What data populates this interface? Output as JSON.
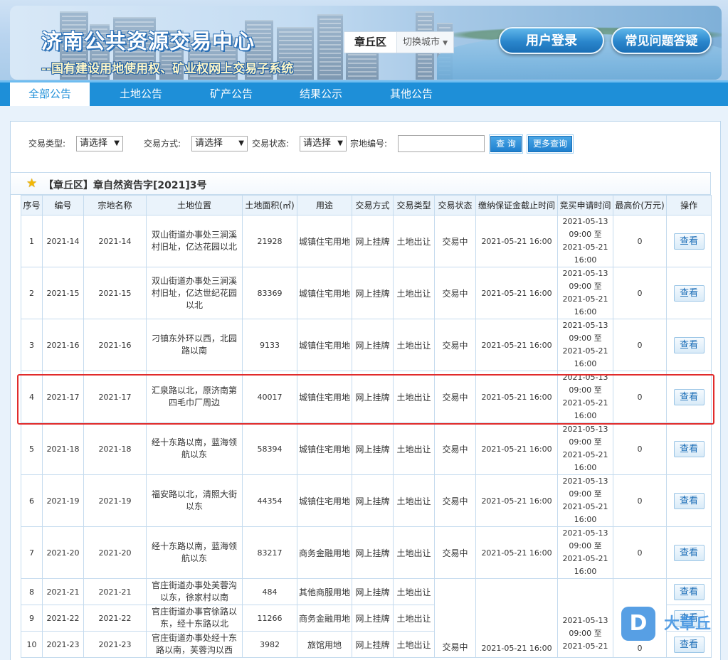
{
  "header": {
    "title": "济南公共资源交易中心",
    "subtitle": "--国有建设用地使用权、矿业权网上交易子系统",
    "city_current": "章丘区",
    "city_switch": "切换城市",
    "login_label": "用户登录",
    "faq_label": "常见问题答疑"
  },
  "nav": {
    "items": [
      {
        "label": "全部公告",
        "active": true
      },
      {
        "label": "土地公告",
        "active": false
      },
      {
        "label": "矿产公告",
        "active": false
      },
      {
        "label": "结果公示",
        "active": false
      },
      {
        "label": "其他公告",
        "active": false
      }
    ]
  },
  "filters": {
    "trade_type_label": "交易类型:",
    "trade_type_value": "请选择",
    "trade_mode_label": "交易方式:",
    "trade_mode_value": "请选择",
    "trade_status_label": "交易状态:",
    "trade_status_value": "请选择",
    "parcel_no_label": "宗地编号:",
    "parcel_no_value": "",
    "query_button": "查 询",
    "more_query_button": "更多查询"
  },
  "notice": {
    "title": "【章丘区】章自然资告字[2021]3号"
  },
  "table": {
    "headers": [
      "序号",
      "编号",
      "宗地名称",
      "土地位置",
      "土地面积(㎡)",
      "用途",
      "交易方式",
      "交易类型",
      "交易状态",
      "缴纳保证金截止时间",
      "竞买申请时间",
      "最高价(万元)",
      "操作"
    ],
    "rows": [
      {
        "no": "1",
        "code": "2021-14",
        "name": "2021-14",
        "location": "双山街道办事处三涧溪村旧址，亿达花园以北",
        "area": "21928",
        "use": "城镇住宅用地",
        "mode": "网上挂牌",
        "type": "土地出让",
        "status": "交易中",
        "deposit_deadline": "2021-05-21 16:00",
        "bid_start": "2021-05-13",
        "bid_start_time": "09:00 至",
        "bid_end": "2021-05-21",
        "bid_end_time": "16:00",
        "max_price": "0",
        "action": "查看"
      },
      {
        "no": "2",
        "code": "2021-15",
        "name": "2021-15",
        "location": "双山街道办事处三涧溪村旧址，亿达世纪花园以北",
        "area": "83369",
        "use": "城镇住宅用地",
        "mode": "网上挂牌",
        "type": "土地出让",
        "status": "交易中",
        "deposit_deadline": "2021-05-21 16:00",
        "bid_start": "2021-05-13",
        "bid_start_time": "09:00 至",
        "bid_end": "2021-05-21",
        "bid_end_time": "16:00",
        "max_price": "0",
        "action": "查看"
      },
      {
        "no": "3",
        "code": "2021-16",
        "name": "2021-16",
        "location": "刁镇东外环以西，北园路以南",
        "area": "9133",
        "use": "城镇住宅用地",
        "mode": "网上挂牌",
        "type": "土地出让",
        "status": "交易中",
        "deposit_deadline": "2021-05-21 16:00",
        "bid_start": "2021-05-13",
        "bid_start_time": "09:00 至",
        "bid_end": "2021-05-21",
        "bid_end_time": "16:00",
        "max_price": "0",
        "action": "查看"
      },
      {
        "no": "4",
        "code": "2021-17",
        "name": "2021-17",
        "location": "汇泉路以北，原济南第四毛巾厂周边",
        "area": "40017",
        "use": "城镇住宅用地",
        "mode": "网上挂牌",
        "type": "土地出让",
        "status": "交易中",
        "deposit_deadline": "2021-05-21 16:00",
        "bid_start": "2021-05-13",
        "bid_start_time": "09:00 至",
        "bid_end": "2021-05-21",
        "bid_end_time": "16:00",
        "max_price": "0",
        "action": "查看"
      },
      {
        "no": "5",
        "code": "2021-18",
        "name": "2021-18",
        "location": "经十东路以南，蓝海领航以东",
        "area": "58394",
        "use": "城镇住宅用地",
        "mode": "网上挂牌",
        "type": "土地出让",
        "status": "交易中",
        "deposit_deadline": "2021-05-21 16:00",
        "bid_start": "2021-05-13",
        "bid_start_time": "09:00 至",
        "bid_end": "2021-05-21",
        "bid_end_time": "16:00",
        "max_price": "0",
        "action": "查看"
      },
      {
        "no": "6",
        "code": "2021-19",
        "name": "2021-19",
        "location": "福安路以北，清照大街以东",
        "area": "44354",
        "use": "城镇住宅用地",
        "mode": "网上挂牌",
        "type": "土地出让",
        "status": "交易中",
        "deposit_deadline": "2021-05-21 16:00",
        "bid_start": "2021-05-13",
        "bid_start_time": "09:00 至",
        "bid_end": "2021-05-21",
        "bid_end_time": "16:00",
        "max_price": "0",
        "action": "查看"
      },
      {
        "no": "7",
        "code": "2021-20",
        "name": "2021-20",
        "location": "经十东路以南，蓝海领航以东",
        "area": "83217",
        "use": "商务金融用地",
        "mode": "网上挂牌",
        "type": "土地出让",
        "status": "交易中",
        "deposit_deadline": "2021-05-21 16:00",
        "bid_start": "2021-05-13",
        "bid_start_time": "09:00 至",
        "bid_end": "2021-05-21",
        "bid_end_time": "16:00",
        "max_price": "0",
        "action": "查看"
      }
    ],
    "group_rows": [
      {
        "no": "8",
        "code": "2021-21",
        "name": "2021-21",
        "location": "官庄街道办事处芙蓉沟以东，徐家村以南",
        "area": "484",
        "use": "其他商服用地",
        "mode": "网上挂牌",
        "type": "土地出让",
        "action": "查看"
      },
      {
        "no": "9",
        "code": "2021-22",
        "name": "2021-22",
        "location": "官庄街道办事官徐路以东，经十东路以北",
        "area": "11266",
        "use": "商务金融用地",
        "mode": "网上挂牌",
        "type": "土地出让",
        "action": "查看"
      },
      {
        "no": "10",
        "code": "2021-23",
        "name": "2021-23",
        "location": "官庄街道办事处经十东路以南，芙蓉沟以西",
        "area": "3982",
        "use": "旅馆用地",
        "mode": "网上挂牌",
        "type": "土地出让",
        "action": "查看"
      }
    ],
    "group_shared": {
      "status": "交易中",
      "deposit_deadline": "2021-05-21 16:00",
      "bid_start": "2021-05-13",
      "bid_start_time": "09:00 至",
      "bid_end": "2021-05-21",
      "max_price": "0"
    }
  },
  "watermark": {
    "badge": "D",
    "text": "大章丘"
  },
  "colors": {
    "nav_bg": "#1e8fd8",
    "highlight": "#e12b2b",
    "header_cell_bg": "#eaf3fb",
    "border": "#c5dbee"
  }
}
